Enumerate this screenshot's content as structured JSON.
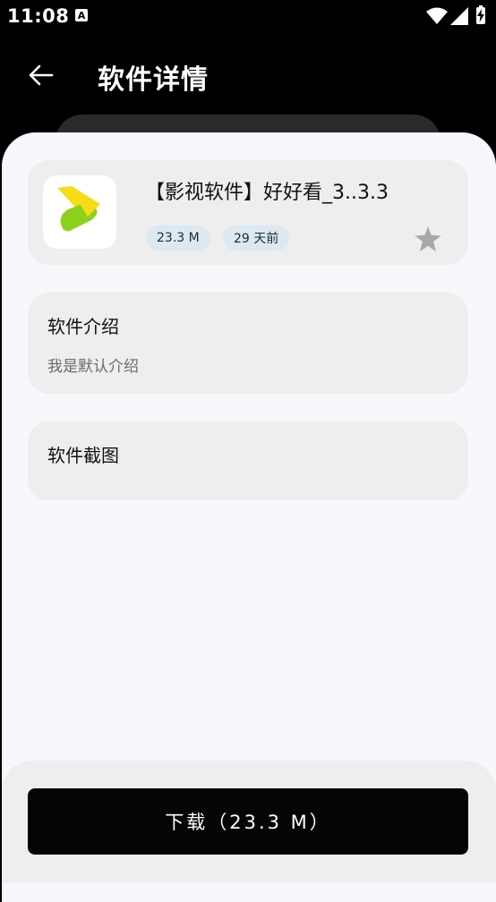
{
  "status_bar": {
    "time": "11:08",
    "notification_icon_letter": "A",
    "icons": [
      "wifi-icon",
      "signal-icon",
      "battery-charging-icon"
    ]
  },
  "header": {
    "back_icon": "arrow-left-icon",
    "title": "软件详情"
  },
  "app": {
    "name": "【影视软件】好好看_3..3.3",
    "size": "23.3 M",
    "updated": "29 天前",
    "favorite_icon": "star-icon",
    "icon_colors": {
      "yellow": "#f5dc17",
      "green": "#8ed11c"
    }
  },
  "intro": {
    "title": "软件介绍",
    "description": "我是默认介绍"
  },
  "screenshots": {
    "title": "软件截图"
  },
  "download": {
    "label": "下载（23.3 M）"
  },
  "colors": {
    "sheet_bg": "#f7f7fc",
    "card_bg": "#eeeeee",
    "chip_bg": "#dde8f1",
    "button_bg": "#050505"
  }
}
